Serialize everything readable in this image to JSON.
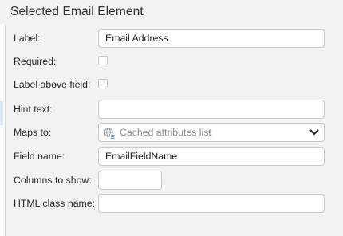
{
  "panel": {
    "title": "Selected Email Element"
  },
  "fields": {
    "label": {
      "label": "Label:",
      "value": "Email Address"
    },
    "required": {
      "label": "Required:",
      "checked": false
    },
    "label_above": {
      "label": "Label above field:",
      "checked": false
    },
    "hint": {
      "label": "Hint text:",
      "value": ""
    },
    "maps_to": {
      "label": "Maps to:",
      "placeholder": "Cached attributes list",
      "icon": "globe-list-icon"
    },
    "field_name": {
      "label": "Field name:",
      "value": "EmailFieldName"
    },
    "columns": {
      "label": "Columns to show:",
      "value": ""
    },
    "html_class": {
      "label": "HTML class name:",
      "value": ""
    }
  }
}
